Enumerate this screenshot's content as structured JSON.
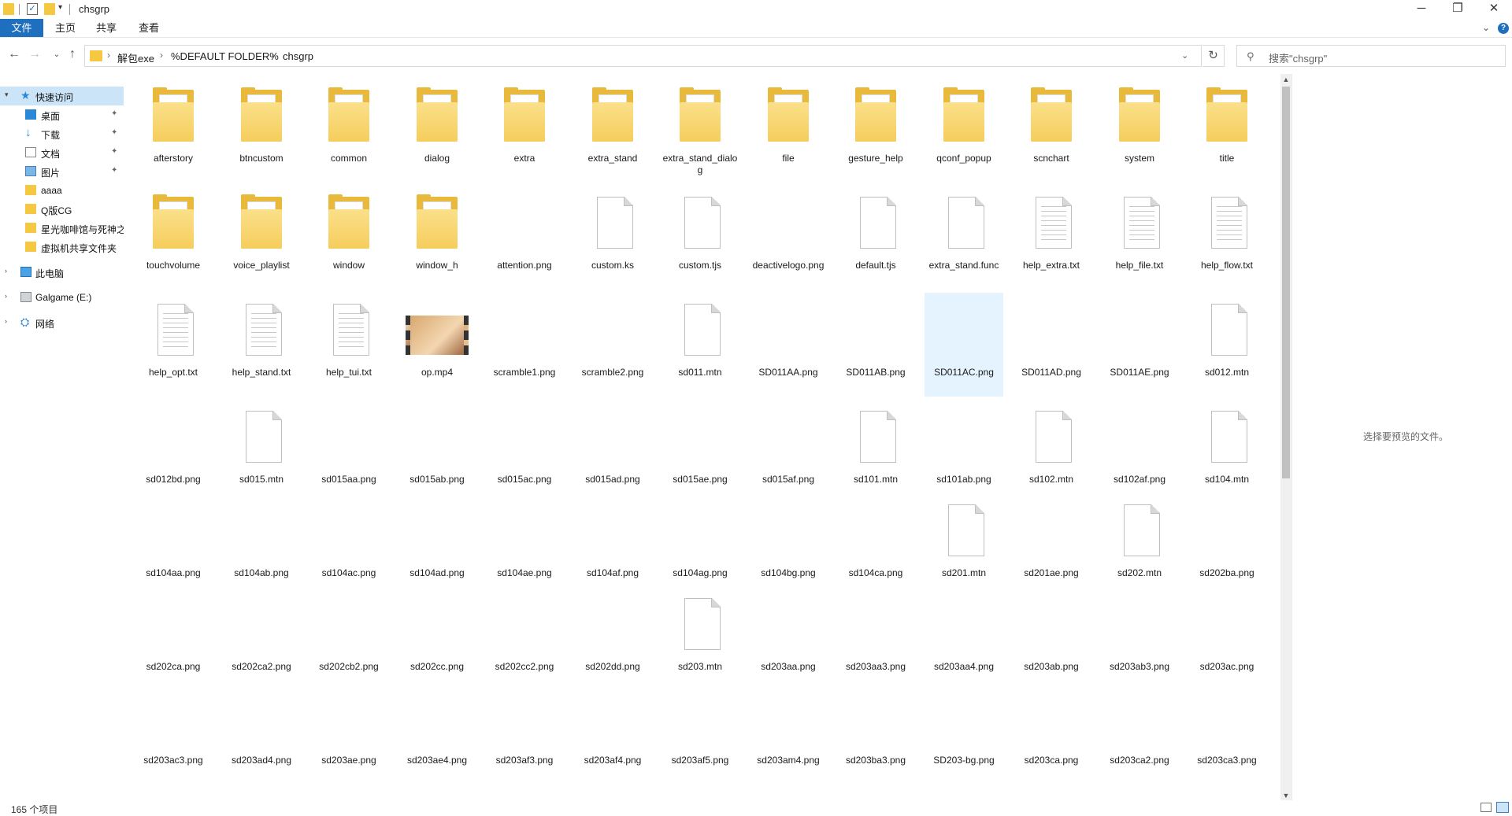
{
  "window": {
    "title": "chsgrp",
    "controls": {
      "minimize": "─",
      "maximize": "❐",
      "close": "✕"
    }
  },
  "ribbon": {
    "tabs": [
      "文件",
      "主页",
      "共享",
      "查看"
    ],
    "help": "?"
  },
  "address": {
    "crumbs": [
      "解包exe",
      "%DEFAULT FOLDER%",
      "chsgrp"
    ]
  },
  "search": {
    "placeholder": "搜索\"chsgrp\""
  },
  "sidebar": {
    "quick_access": "快速访问",
    "items": [
      "桌面",
      "下载",
      "文档",
      "图片",
      "aaaa",
      "Q版CG",
      "星光咖啡馆与死神之",
      "虚拟机共享文件夹"
    ],
    "this_pc": "此电脑",
    "drive": "Galgame (E:)",
    "network": "网络"
  },
  "files": [
    {
      "name": "afterstory",
      "kind": "folder"
    },
    {
      "name": "btncustom",
      "kind": "folder"
    },
    {
      "name": "common",
      "kind": "folder"
    },
    {
      "name": "dialog",
      "kind": "folder"
    },
    {
      "name": "extra",
      "kind": "folder"
    },
    {
      "name": "extra_stand",
      "kind": "folder"
    },
    {
      "name": "extra_stand_dialog",
      "kind": "folder"
    },
    {
      "name": "file",
      "kind": "folder"
    },
    {
      "name": "gesture_help",
      "kind": "folder"
    },
    {
      "name": "qconf_popup",
      "kind": "folder"
    },
    {
      "name": "scnchart",
      "kind": "folder"
    },
    {
      "name": "system",
      "kind": "folder"
    },
    {
      "name": "title",
      "kind": "folder"
    },
    {
      "name": "touchvolume",
      "kind": "folder"
    },
    {
      "name": "voice_playlist",
      "kind": "folder"
    },
    {
      "name": "window",
      "kind": "folder"
    },
    {
      "name": "window_h",
      "kind": "folder"
    },
    {
      "name": "attention.png",
      "kind": "image",
      "color": "#8a6a64"
    },
    {
      "name": "custom.ks",
      "kind": "blank"
    },
    {
      "name": "custom.tjs",
      "kind": "blank"
    },
    {
      "name": "deactivelogo.png",
      "kind": "image",
      "color": "#f1dde0"
    },
    {
      "name": "default.tjs",
      "kind": "blank"
    },
    {
      "name": "extra_stand.func",
      "kind": "blank"
    },
    {
      "name": "help_extra.txt",
      "kind": "text"
    },
    {
      "name": "help_file.txt",
      "kind": "text"
    },
    {
      "name": "help_flow.txt",
      "kind": "text"
    },
    {
      "name": "help_opt.txt",
      "kind": "text"
    },
    {
      "name": "help_stand.txt",
      "kind": "text"
    },
    {
      "name": "help_tui.txt",
      "kind": "text"
    },
    {
      "name": "op.mp4",
      "kind": "video"
    },
    {
      "name": "scramble1.png",
      "kind": "image",
      "color": "#ede7e2"
    },
    {
      "name": "scramble2.png",
      "kind": "image",
      "color": "#f7f6f1"
    },
    {
      "name": "sd011.mtn",
      "kind": "blank"
    },
    {
      "name": "SD011AA.png",
      "kind": "image",
      "color": "#3b3a4a"
    },
    {
      "name": "SD011AB.png",
      "kind": "image",
      "color": "#3b3a4a"
    },
    {
      "name": "SD011AC.png",
      "kind": "image",
      "color": "#3b3a4a",
      "selected": true
    },
    {
      "name": "SD011AD.png",
      "kind": "image",
      "color": "#3b3a4a"
    },
    {
      "name": "SD011AE.png",
      "kind": "image",
      "color": "#3b3a4a"
    },
    {
      "name": "sd012.mtn",
      "kind": "blank"
    },
    {
      "name": "sd012bd.png",
      "kind": "image",
      "color": "#b6b3a8"
    },
    {
      "name": "sd015.mtn",
      "kind": "blank"
    },
    {
      "name": "sd015aa.png",
      "kind": "image",
      "color": "#9b8596"
    },
    {
      "name": "sd015ab.png",
      "kind": "image",
      "color": "#9b8596"
    },
    {
      "name": "sd015ac.png",
      "kind": "image",
      "color": "#9b8596"
    },
    {
      "name": "sd015ad.png",
      "kind": "image",
      "color": "#9b8596"
    },
    {
      "name": "sd015ae.png",
      "kind": "image",
      "color": "#9b8596"
    },
    {
      "name": "sd015af.png",
      "kind": "image",
      "color": "#9b8596"
    },
    {
      "name": "sd101.mtn",
      "kind": "blank"
    },
    {
      "name": "sd101ab.png",
      "kind": "image",
      "color": "#8e5f5b"
    },
    {
      "name": "sd102.mtn",
      "kind": "blank"
    },
    {
      "name": "sd102af.png",
      "kind": "image",
      "color": "#e6c4c8"
    },
    {
      "name": "sd104.mtn",
      "kind": "blank"
    },
    {
      "name": "sd104aa.png",
      "kind": "image",
      "color": "#f2a8b8"
    },
    {
      "name": "sd104ab.png",
      "kind": "image",
      "color": "#f2a8b8"
    },
    {
      "name": "sd104ac.png",
      "kind": "image",
      "color": "#f2a8b8"
    },
    {
      "name": "sd104ad.png",
      "kind": "image",
      "color": "#f2a8b8"
    },
    {
      "name": "sd104ae.png",
      "kind": "image",
      "color": "#f2a8b8"
    },
    {
      "name": "sd104af.png",
      "kind": "image",
      "color": "#f2a8b8"
    },
    {
      "name": "sd104ag.png",
      "kind": "image",
      "color": "#f2a8b8"
    },
    {
      "name": "sd104bg.png",
      "kind": "image",
      "color": "#f4b3c0"
    },
    {
      "name": "sd104ca.png",
      "kind": "image",
      "color": "#f2a8b8"
    },
    {
      "name": "sd201.mtn",
      "kind": "blank"
    },
    {
      "name": "sd201ae.png",
      "kind": "image",
      "color": "#b5aac8"
    },
    {
      "name": "sd202.mtn",
      "kind": "blank"
    },
    {
      "name": "sd202ba.png",
      "kind": "image",
      "color": "#adc1e0"
    },
    {
      "name": "sd202ca.png",
      "kind": "image",
      "color": "#c6d6ee"
    },
    {
      "name": "sd202ca2.png",
      "kind": "image",
      "color": "#c6d6ee"
    },
    {
      "name": "sd202cb2.png",
      "kind": "image",
      "color": "#c6d6ee"
    },
    {
      "name": "sd202cc.png",
      "kind": "image",
      "color": "#c6d6ee"
    },
    {
      "name": "sd202cc2.png",
      "kind": "image",
      "color": "#c6d6ee"
    },
    {
      "name": "sd202dd.png",
      "kind": "image",
      "color": "#c6d6ee"
    },
    {
      "name": "sd203.mtn",
      "kind": "blank"
    },
    {
      "name": "sd203aa.png",
      "kind": "image",
      "color": "#c98b4e"
    },
    {
      "name": "sd203aa3.png",
      "kind": "image",
      "color": "#c98b4e"
    },
    {
      "name": "sd203aa4.png",
      "kind": "image",
      "color": "#c98b4e"
    },
    {
      "name": "sd203ab.png",
      "kind": "image",
      "color": "#c98b4e"
    },
    {
      "name": "sd203ab3.png",
      "kind": "image",
      "color": "#c98b4e"
    },
    {
      "name": "sd203ac.png",
      "kind": "image",
      "color": "#c98b4e"
    },
    {
      "name": "sd203ac3.png",
      "kind": "image",
      "color": "#c98b4e"
    },
    {
      "name": "sd203ad4.png",
      "kind": "image",
      "color": "#c98b4e"
    },
    {
      "name": "sd203ae.png",
      "kind": "image",
      "color": "#c98b4e"
    },
    {
      "name": "sd203ae4.png",
      "kind": "image",
      "color": "#c98b4e"
    },
    {
      "name": "sd203af3.png",
      "kind": "image",
      "color": "#c98b4e"
    },
    {
      "name": "sd203af4.png",
      "kind": "image",
      "color": "#c98b4e"
    },
    {
      "name": "sd203af5.png",
      "kind": "image",
      "color": "#c98b4e"
    },
    {
      "name": "sd203am4.png",
      "kind": "image",
      "color": "#c98b4e"
    },
    {
      "name": "sd203ba3.png",
      "kind": "image",
      "color": "#c98b4e"
    },
    {
      "name": "SD203-bg.png",
      "kind": "image",
      "color": "#e0a050"
    },
    {
      "name": "sd203ca.png",
      "kind": "image",
      "color": "#c98b4e"
    },
    {
      "name": "sd203ca2.png",
      "kind": "image",
      "color": "#c98b4e"
    },
    {
      "name": "sd203ca3.png",
      "kind": "image",
      "color": "#c98b4e"
    }
  ],
  "preview": {
    "empty_text": "选择要预览的文件。"
  },
  "status": {
    "count": "165 个项目"
  }
}
